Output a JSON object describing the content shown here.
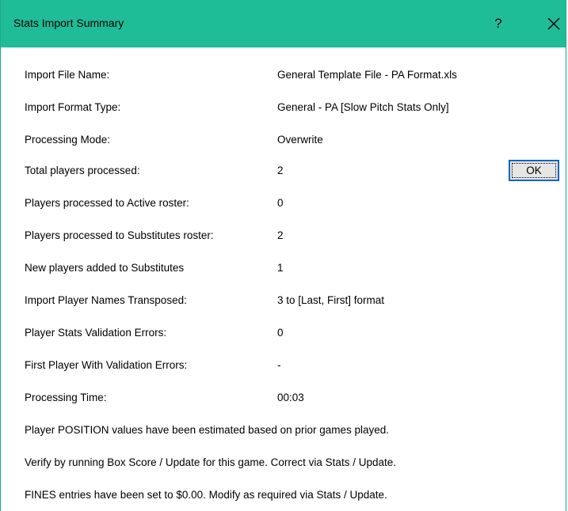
{
  "window": {
    "title": "Stats Import Summary",
    "help_label": "?",
    "colors": {
      "titlebar": "#1fbc98",
      "ok_focus_border": "#0a64c8"
    }
  },
  "summary": {
    "rows": [
      {
        "label": "Import File Name:",
        "value": "General Template File - PA Format.xls"
      },
      {
        "label": "Import Format Type:",
        "value": "General - PA [Slow Pitch Stats Only]"
      },
      {
        "label": "Processing Mode:",
        "value": "Overwrite"
      },
      {
        "label": "Total players processed:",
        "value": "2"
      },
      {
        "label": "Players processed to Active roster:",
        "value": "0"
      },
      {
        "label": "Players processed to Substitutes roster:",
        "value": "2"
      },
      {
        "label": "New players added to Substitutes",
        "value": "1"
      },
      {
        "label": "Import Player Names Transposed:",
        "value": "3 to [Last, First] format"
      },
      {
        "label": "Player Stats Validation Errors:",
        "value": "0"
      },
      {
        "label": "First Player With Validation Errors:",
        "value": "-"
      },
      {
        "label": "Processing Time:",
        "value": "00:03"
      }
    ],
    "notes": [
      "Player POSITION values have been estimated based on prior games played.",
      "Verify by running Box Score / Update for this game. Correct via Stats / Update.",
      "FINES entries have been set to $0.00. Modify as required via Stats / Update."
    ]
  },
  "buttons": {
    "ok_label": "OK"
  }
}
